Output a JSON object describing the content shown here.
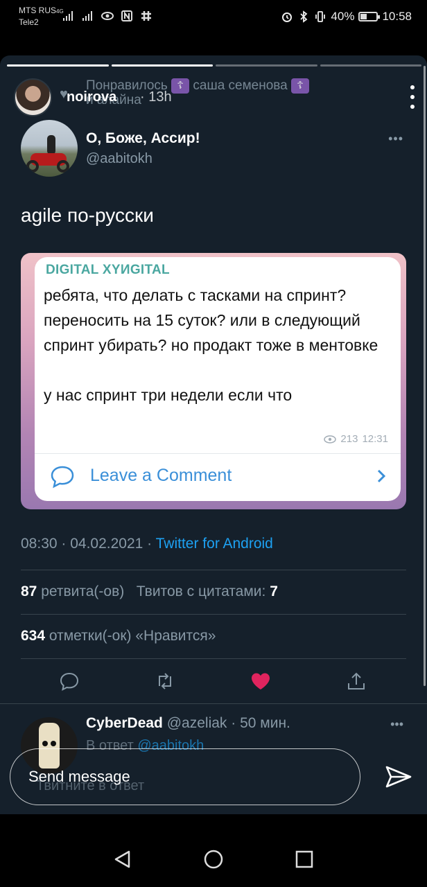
{
  "statusbar": {
    "carrier_line1": "MTS RUS",
    "carrier_line2": "Tele2",
    "network_label": "4G",
    "battery_text": "40%",
    "battery_level": 0.4,
    "time": "10:58"
  },
  "story": {
    "progress_segments": 4,
    "username": "noirova",
    "time_ago": "13h",
    "liked_by_text": "Понравилось",
    "liked_by_name": "саша семенова",
    "liked_by_more": "и алайна",
    "menu_icon": "more-vertical-icon"
  },
  "tweet": {
    "display_name": "О, Боже, Ассир!",
    "handle": "@aabitokh",
    "more_icon": "ellipsis-icon",
    "text": "agile по-русски",
    "image": {
      "chat_title": "DIGITAL XYИGITAL",
      "message": "ребята, что делать с тасками на спринт? переносить на 15 суток? или в следующий спринт убирать? но продакт тоже в ментовке\n\nу нас спринт три недели если что",
      "views": "213",
      "time": "12:31",
      "comment_label": "Leave a Comment"
    },
    "timestamp": "08:30 · 04.02.2021 ·",
    "source": "Twitter for Android",
    "retweets_count": "87",
    "retweets_label": "ретвита(-ов)",
    "quotes_label": "Твитов с цитатами:",
    "quotes_count": "7",
    "likes_count": "634",
    "likes_label": "отметки(-ок) «Нравится»",
    "like_color": "#e0245e",
    "accent_color": "#1da1f2"
  },
  "reply": {
    "display_name": "CyberDead",
    "handle": "@azeliak",
    "time_ago": "· 50 мин.",
    "in_reply_prefix": "В ответ",
    "in_reply_to": "@aabitokh",
    "reply_placeholder": "Твитните в ответ"
  },
  "send": {
    "placeholder": "Send message"
  },
  "navbar": {
    "back_icon": "back-triangle-icon",
    "home_icon": "home-circle-icon",
    "recents_icon": "recents-square-icon"
  }
}
